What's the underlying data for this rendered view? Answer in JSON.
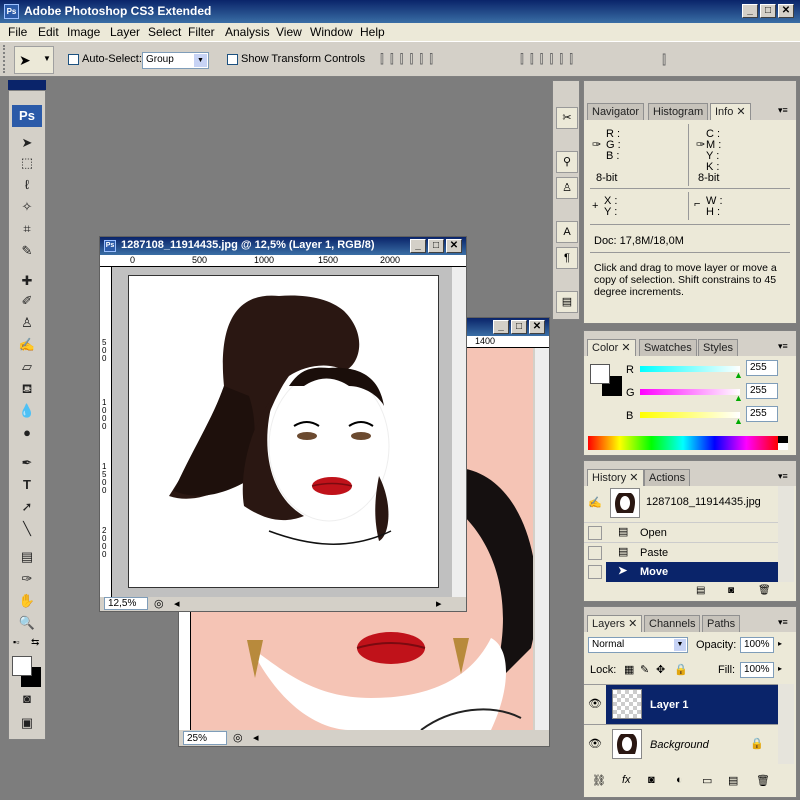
{
  "app": {
    "title": "Adobe Photoshop CS3 Extended",
    "logo": "Ps"
  },
  "menu": [
    "File",
    "Edit",
    "Image",
    "Layer",
    "Select",
    "Filter",
    "Analysis",
    "View",
    "Window",
    "Help"
  ],
  "options": {
    "auto_select_label": "Auto-Select:",
    "auto_select_value": "Group",
    "show_transform_label": "Show Transform Controls"
  },
  "doc_front": {
    "title": "1287108_11914435.jpg @ 12,5% (Layer 1, RGB/8)",
    "ruler_ticks": [
      "0",
      "500",
      "1000",
      "1500",
      "2000"
    ],
    "vruler_ticks": [
      "5\n0\n0",
      "1\n0\n0\n0",
      "1\n5\n0\n0",
      "2\n0\n0\n0"
    ],
    "zoom": "12,5%"
  },
  "doc_back": {
    "ruler_tick": "1400",
    "zoom": "25%"
  },
  "info_panel": {
    "tabs": [
      "Navigator",
      "Histogram",
      "Info"
    ],
    "rgb_labels": [
      "R :",
      "G :",
      "B :"
    ],
    "bit_left": "8-bit",
    "cmyk_labels": [
      "C :",
      "M :",
      "Y :",
      "K :"
    ],
    "bit_right": "8-bit",
    "xy_labels": [
      "X :",
      "Y :"
    ],
    "wh_labels": [
      "W :",
      "H :"
    ],
    "doc_size": "Doc: 17,8M/18,0M",
    "hint": "Click and drag to move layer or move a copy of selection. Shift constrains to 45 degree increments."
  },
  "color_panel": {
    "tabs": [
      "Color",
      "Swatches",
      "Styles"
    ],
    "channels": [
      {
        "label": "R",
        "value": "255",
        "color": "#00e5e5"
      },
      {
        "label": "G",
        "value": "255",
        "color": "#e500e5"
      },
      {
        "label": "B",
        "value": "255",
        "color": "#e5e500"
      }
    ]
  },
  "history_panel": {
    "tabs": [
      "History",
      "Actions"
    ],
    "snapshot": "1287108_11914435.jpg",
    "items": [
      "Open",
      "Paste",
      "Move"
    ]
  },
  "layers_panel": {
    "tabs": [
      "Layers",
      "Channels",
      "Paths"
    ],
    "blend_mode": "Normal",
    "opacity_label": "Opacity:",
    "opacity": "100%",
    "lock_label": "Lock:",
    "fill_label": "Fill:",
    "fill": "100%",
    "layers": [
      "Layer 1",
      "Background"
    ]
  },
  "colors": {
    "title_bar": "#0a246a",
    "selection": "#0a246a",
    "canvas_bg": "#7d7d7d",
    "skin_bg": "#f5c4b5"
  }
}
